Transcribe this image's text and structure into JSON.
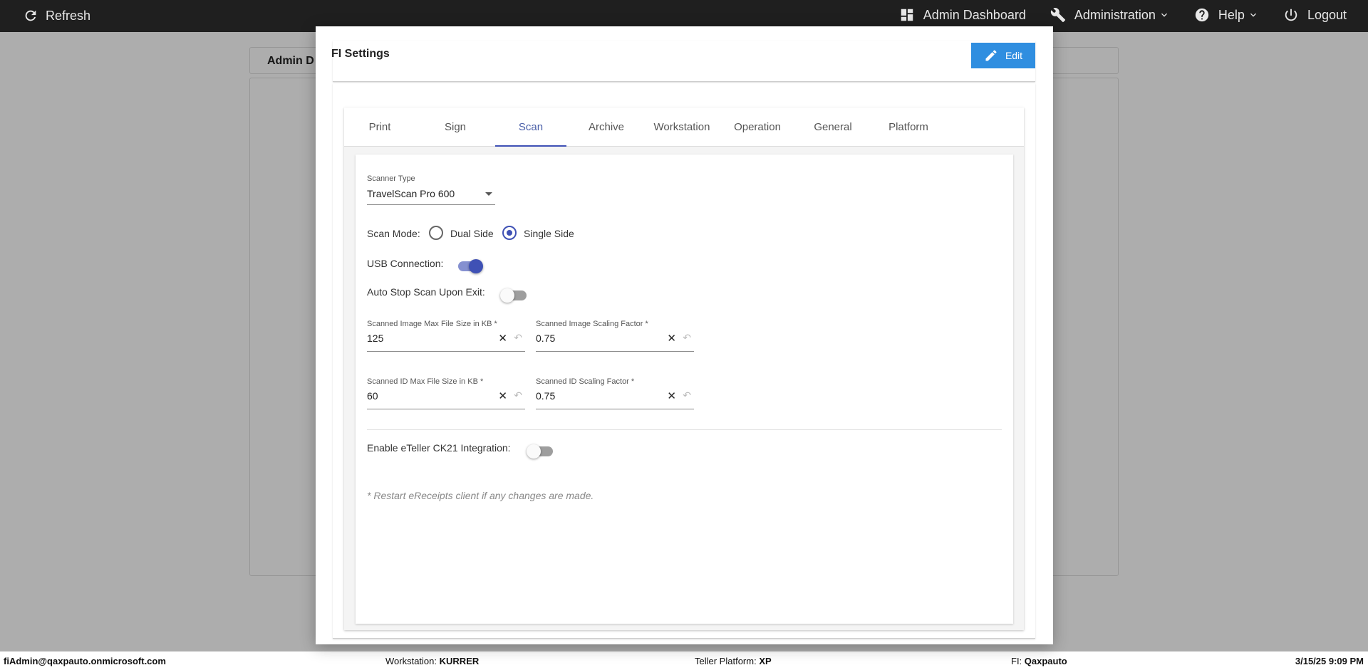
{
  "topbar": {
    "refresh_label": "Refresh",
    "admin_dashboard_label": "Admin Dashboard",
    "administration_label": "Administration",
    "help_label": "Help",
    "logout_label": "Logout"
  },
  "background": {
    "card_title": "Admin D"
  },
  "statusbar": {
    "user": "fiAdmin@qaxpauto.onmicrosoft.com",
    "workstation_label": "Workstation:",
    "workstation_value": "KURRER",
    "teller_platform_label": "Teller Platform:",
    "teller_platform_value": "XP",
    "fi_label": "FI:",
    "fi_value": "Qaxpauto",
    "datetime": "3/15/25 9:09 PM"
  },
  "modal": {
    "title": "FI Settings",
    "edit_label": "Edit",
    "tabs": [
      {
        "label": "Print"
      },
      {
        "label": "Sign"
      },
      {
        "label": "Scan"
      },
      {
        "label": "Archive"
      },
      {
        "label": "Workstation"
      },
      {
        "label": "Operation"
      },
      {
        "label": "General"
      },
      {
        "label": "Platform"
      }
    ],
    "active_tab": "Scan",
    "scan": {
      "scanner_type_label": "Scanner Type",
      "scanner_type_value": "TravelScan Pro 600",
      "scan_mode_label": "Scan Mode:",
      "dual_side_label": "Dual Side",
      "single_side_label": "Single Side",
      "scan_mode_selected": "Single Side",
      "usb_connection_label": "USB Connection:",
      "usb_connection_on": true,
      "auto_stop_label": "Auto Stop Scan Upon Exit:",
      "auto_stop_on": false,
      "image_max_size_label": "Scanned Image Max File Size in KB *",
      "image_max_size_value": "125",
      "image_scaling_label": "Scanned Image Scaling Factor *",
      "image_scaling_value": "0.75",
      "id_max_size_label": "Scanned ID Max File Size in KB *",
      "id_max_size_value": "60",
      "id_scaling_label": "Scanned ID Scaling Factor *",
      "id_scaling_value": "0.75",
      "eteller_label": "Enable eTeller CK21 Integration:",
      "eteller_on": false,
      "restart_note": "* Restart eReceipts client if any changes are made."
    }
  }
}
